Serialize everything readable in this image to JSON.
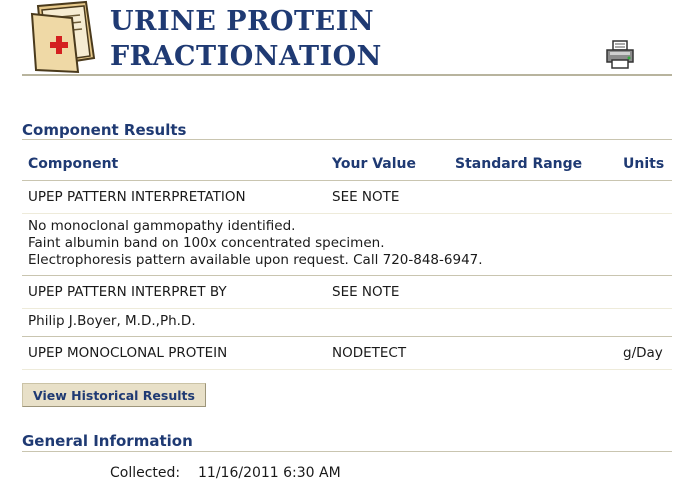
{
  "header": {
    "title_line1": "URINE PROTEIN",
    "title_line2": "FRACTIONATION",
    "logo_icon": "medical-folder-icon",
    "print_icon": "printer-icon"
  },
  "component_results": {
    "heading": "Component Results",
    "columns": {
      "component": "Component",
      "your_value": "Your Value",
      "standard_range": "Standard Range",
      "units": "Units"
    },
    "rows": [
      {
        "component": "UPEP PATTERN INTERPRETATION",
        "value": "SEE NOTE",
        "range": "",
        "units": "",
        "note": [
          "No monoclonal gammopathy identified.",
          "Faint albumin band on 100x concentrated specimen.",
          "Electrophoresis pattern available upon request. Call 720-848-6947."
        ]
      },
      {
        "component": "UPEP PATTERN INTERPRET BY",
        "value": "SEE NOTE",
        "range": "",
        "units": "",
        "note": [
          "Philip J.Boyer, M.D.,Ph.D."
        ]
      },
      {
        "component": "UPEP MONOCLONAL PROTEIN",
        "value": "NODETECT",
        "range": "",
        "units": "g/Day"
      }
    ]
  },
  "buttons": {
    "view_historical": "View Historical Results"
  },
  "general_information": {
    "heading": "General Information",
    "collected_label": "Collected:",
    "collected_value": "11/16/2011 6:30 AM"
  },
  "colors": {
    "heading_blue": "#1f3a73",
    "rule": "#c9c5b0",
    "button_bg": "#e8e0c8"
  }
}
